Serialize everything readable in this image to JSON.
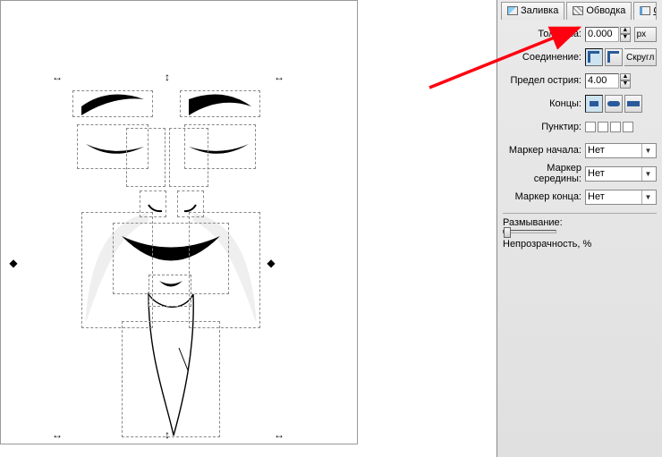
{
  "tabs": {
    "fill": "Заливка",
    "stroke": "Обводка",
    "style": "Стиль обв"
  },
  "stroke": {
    "width_label": "Толщина:",
    "width_value": "0.000",
    "unit": "px",
    "join_label": "Соединение:",
    "join_opt_label": "Скругл",
    "miter_label": "Предел острия:",
    "miter_value": "4.00",
    "cap_label": "Концы:",
    "dash_label": "Пунктир:",
    "marker_start_label": "Маркер начала:",
    "marker_mid_label": "Маркер середины:",
    "marker_end_label": "Маркер конца:",
    "marker_none": "Нет"
  },
  "effects": {
    "blur_label": "Размывание:",
    "opacity_label": "Непрозрачность, %"
  }
}
